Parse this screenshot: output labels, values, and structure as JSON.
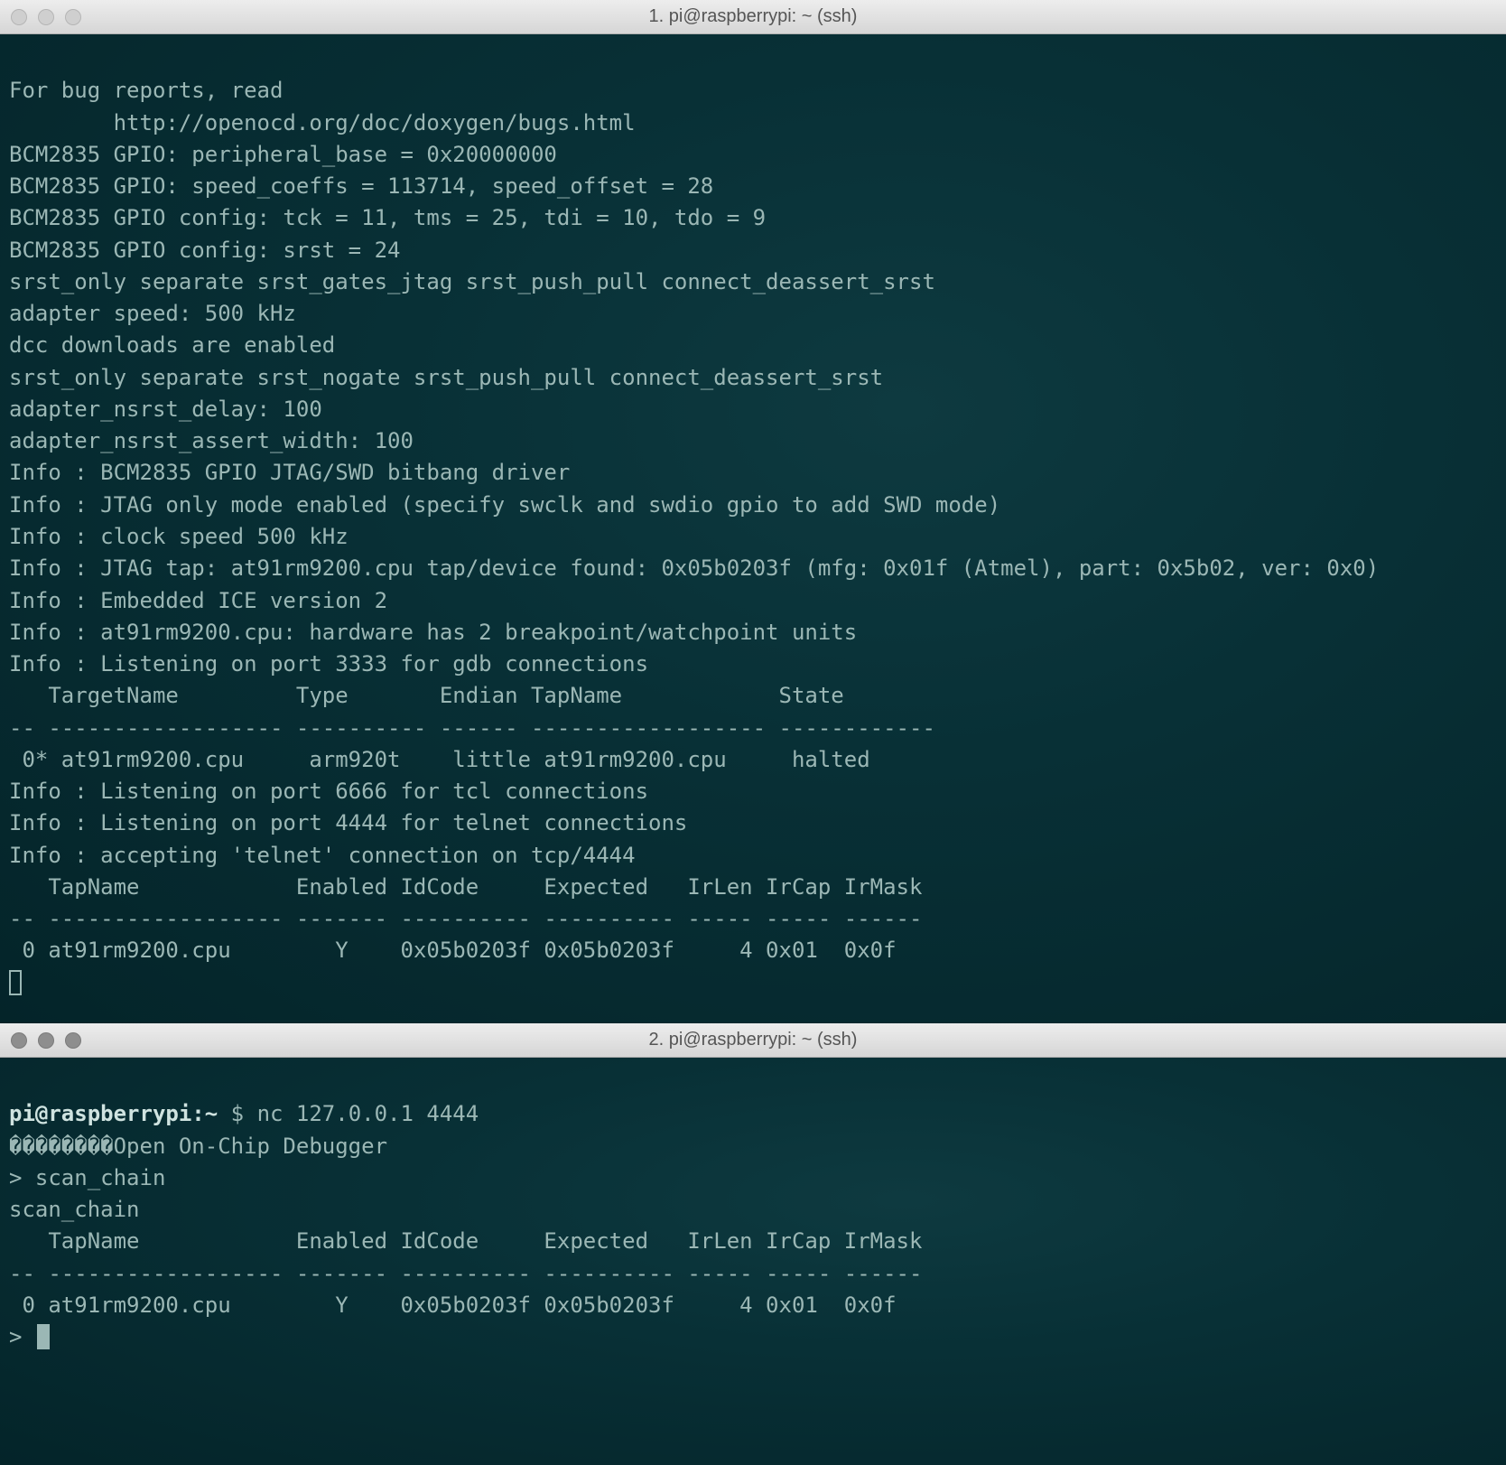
{
  "window1": {
    "title": "1. pi@raspberrypi: ~ (ssh)",
    "lines": [
      "For bug reports, read",
      "        http://openocd.org/doc/doxygen/bugs.html",
      "BCM2835 GPIO: peripheral_base = 0x20000000",
      "BCM2835 GPIO: speed_coeffs = 113714, speed_offset = 28",
      "BCM2835 GPIO config: tck = 11, tms = 25, tdi = 10, tdo = 9",
      "BCM2835 GPIO config: srst = 24",
      "srst_only separate srst_gates_jtag srst_push_pull connect_deassert_srst",
      "adapter speed: 500 kHz",
      "dcc downloads are enabled",
      "srst_only separate srst_nogate srst_push_pull connect_deassert_srst",
      "adapter_nsrst_delay: 100",
      "adapter_nsrst_assert_width: 100",
      "Info : BCM2835 GPIO JTAG/SWD bitbang driver",
      "Info : JTAG only mode enabled (specify swclk and swdio gpio to add SWD mode)",
      "Info : clock speed 500 kHz",
      "Info : JTAG tap: at91rm9200.cpu tap/device found: 0x05b0203f (mfg: 0x01f (Atmel), part: 0x5b02, ver: 0x0)",
      "Info : Embedded ICE version 2",
      "Info : at91rm9200.cpu: hardware has 2 breakpoint/watchpoint units",
      "Info : Listening on port 3333 for gdb connections",
      "   TargetName         Type       Endian TapName            State       ",
      "-- ------------------ ---------- ------ ------------------ ------------",
      " 0* at91rm9200.cpu     arm920t    little at91rm9200.cpu     halted",
      "Info : Listening on port 6666 for tcl connections",
      "Info : Listening on port 4444 for telnet connections",
      "Info : accepting 'telnet' connection on tcp/4444",
      "   TapName            Enabled IdCode     Expected   IrLen IrCap IrMask",
      "-- ------------------ ------- ---------- ---------- ----- ----- ------",
      " 0 at91rm9200.cpu        Y    0x05b0203f 0x05b0203f     4 0x01  0x0f"
    ]
  },
  "window2": {
    "title": "2. pi@raspberrypi: ~ (ssh)",
    "prompt_host": "pi@raspberrypi",
    "prompt_sep": ":",
    "prompt_path": "~",
    "prompt_dollar": "$",
    "prompt_cmd": "nc 127.0.0.1 4444",
    "banner": "��������Open On-Chip Debugger",
    "input1_prompt": ">",
    "input1_cmd": "scan_chain",
    "lines": [
      "scan_chain",
      "   TapName            Enabled IdCode     Expected   IrLen IrCap IrMask",
      "-- ------------------ ------- ---------- ---------- ----- ----- ------",
      " 0 at91rm9200.cpu        Y    0x05b0203f 0x05b0203f     4 0x01  0x0f"
    ],
    "input2_prompt": ">"
  }
}
